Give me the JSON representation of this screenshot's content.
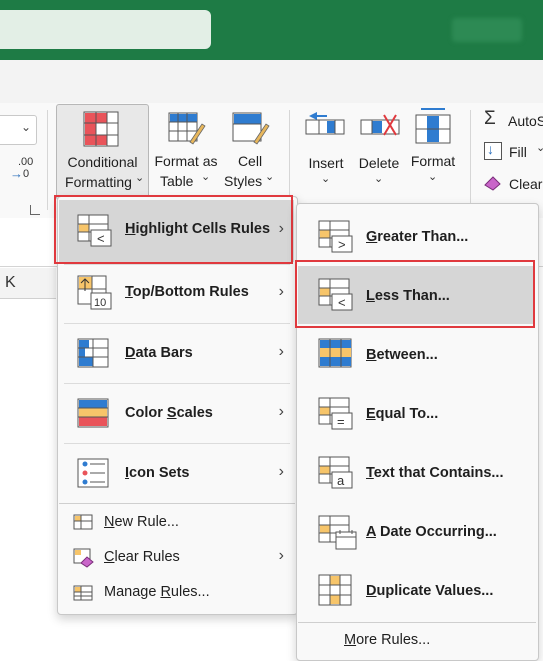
{
  "ribbon": {
    "conditional_formatting": [
      "Conditional",
      "Formatting"
    ],
    "format_as_table": [
      "Format as",
      "Table"
    ],
    "cell_styles": [
      "Cell",
      "Styles"
    ],
    "insert": "Insert",
    "delete": "Delete",
    "format": "Format",
    "autosum": "AutoS",
    "fill": "Fill",
    "clear": "Clear",
    "decimal_label": ".00"
  },
  "sheet": {
    "column_k": "K"
  },
  "menu_main": {
    "items": [
      {
        "pre": "",
        "ul": "H",
        "post": "ighlight Cells Rules",
        "submenu": true
      },
      {
        "pre": "",
        "ul": "T",
        "post": "op/Bottom Rules",
        "submenu": true
      },
      {
        "pre": "",
        "ul": "D",
        "post": "ata Bars",
        "submenu": true
      },
      {
        "pre": "Color ",
        "ul": "S",
        "post": "cales",
        "submenu": true
      },
      {
        "pre": "",
        "ul": "I",
        "post": "con Sets",
        "submenu": true
      }
    ],
    "small_items": [
      {
        "pre": "",
        "ul": "N",
        "post": "ew Rule..."
      },
      {
        "pre": "",
        "ul": "C",
        "post": "lear Rules"
      },
      {
        "pre": "Manage ",
        "ul": "R",
        "post": "ules..."
      }
    ]
  },
  "menu_sub": {
    "items": [
      {
        "pre": "",
        "ul": "G",
        "post": "reater Than..."
      },
      {
        "pre": "",
        "ul": "L",
        "post": "ess Than..."
      },
      {
        "pre": "",
        "ul": "B",
        "post": "etween..."
      },
      {
        "pre": "",
        "ul": "E",
        "post": "qual To..."
      },
      {
        "pre": "",
        "ul": "T",
        "post": "ext that Contains..."
      },
      {
        "pre": "",
        "ul": "A",
        "post": " Date Occurring..."
      },
      {
        "pre": "",
        "ul": "D",
        "post": "uplicate Values..."
      }
    ],
    "more": {
      "pre": "",
      "ul": "M",
      "post": "ore Rules..."
    }
  }
}
